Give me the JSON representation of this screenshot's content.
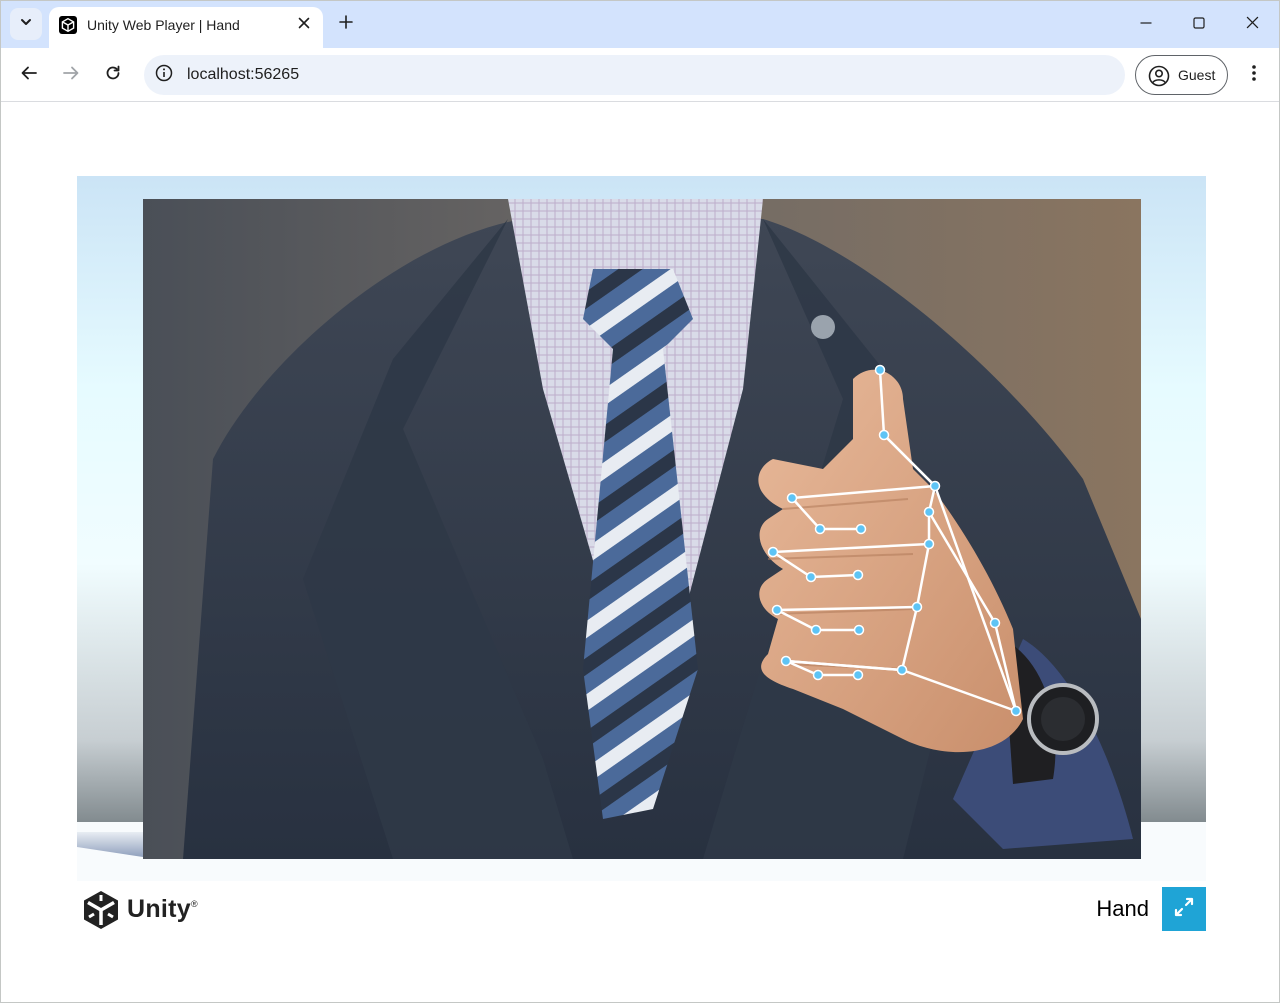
{
  "browser": {
    "tab": {
      "title": "Unity Web Player | Hand",
      "favicon": "unity-icon"
    },
    "address_bar": {
      "url": "localhost:56265"
    },
    "profile": {
      "label": "Guest"
    },
    "icons": [
      "tab-search-icon",
      "close-icon",
      "new-tab-icon",
      "minimize-icon",
      "maximize-icon",
      "back-icon",
      "forward-icon",
      "reload-icon",
      "site-info-icon",
      "profile-icon",
      "more-menu-icon"
    ]
  },
  "unity": {
    "brand": "Unity",
    "build_title": "Hand",
    "fullscreen_icon": "fullscreen-icon",
    "colors": {
      "fullscreen_button": "#1fa4d6",
      "landmark": "#5ec4f5",
      "connection": "#ffffff"
    }
  },
  "hand_tracking": {
    "landmark_count": 21,
    "connection_count": 23
  }
}
